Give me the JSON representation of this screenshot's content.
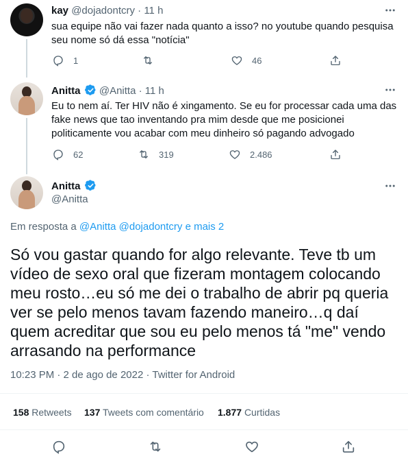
{
  "tweets": [
    {
      "name": "kay",
      "handle": "@dojadontcry",
      "dot": "·",
      "time": "11 h",
      "text": "sua equipe não vai fazer nada quanto a isso? no youtube quando pesquisa seu nome só dá essa \"notícia\"",
      "replies": "1",
      "retweets": "",
      "likes": "46"
    },
    {
      "name": "Anitta",
      "handle": "@Anitta",
      "dot": "·",
      "time": "11 h",
      "text": "Eu to nem aí. Ter HIV não é xingamento. Se eu for processar cada uma das fake news que tao inventando pra mim desde que me posicionei politicamente vou acabar com meu dinheiro só pagando advogado",
      "replies": "62",
      "retweets": "319",
      "likes": "2.486"
    }
  ],
  "main": {
    "name": "Anitta",
    "handle": "@Anitta",
    "reply_prefix": "Em resposta a",
    "reply_mentions": "@Anitta @dojadontcry e mais 2",
    "text": "Só vou gastar quando for algo relevante. Teve tb um vídeo de sexo oral que fizeram montagem colocando meu rosto…eu só me dei o trabalho de abrir pq queria ver se pelo menos tavam fazendo maneiro…q daí quem acreditar que sou eu pelo menos tá \"me\" vendo arrasando na performance",
    "timestamp": "10:23 PM · 2 de ago de 2022 · Twitter for Android",
    "retweets_count": "158",
    "retweets_label": "Retweets",
    "quotes_count": "137",
    "quotes_label": "Tweets com comentário",
    "likes_count": "1.877",
    "likes_label": "Curtidas"
  },
  "colors": {
    "accent": "#1d9bf0",
    "muted": "#536471",
    "text": "#0f1419"
  }
}
